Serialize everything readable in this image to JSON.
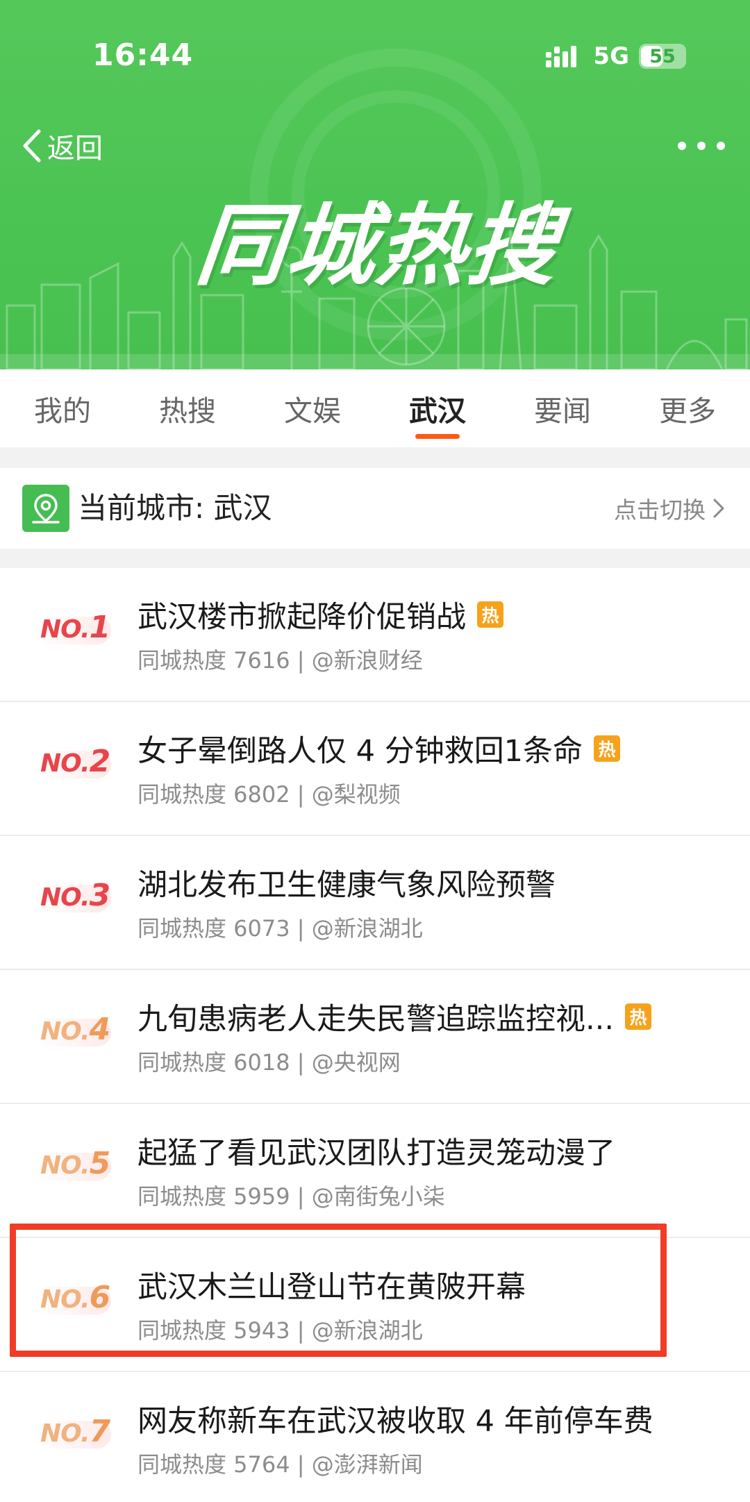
{
  "status_bar": {
    "time": "16:44",
    "network": "5G",
    "battery": "55",
    "battery_level": 0.55
  },
  "header": {
    "back_label": "返回",
    "banner_title": "同城热搜"
  },
  "tabs": [
    {
      "label": "我的",
      "active": false
    },
    {
      "label": "热搜",
      "active": false
    },
    {
      "label": "文娱",
      "active": false
    },
    {
      "label": "武汉",
      "active": true
    },
    {
      "label": "要闻",
      "active": false
    },
    {
      "label": "更多",
      "active": false
    }
  ],
  "city_bar": {
    "label": "当前城市: 武汉",
    "switch_label": "点击切换"
  },
  "hot_badge_label": "热",
  "colors": {
    "brand_green": "#4cc454",
    "tab_indicator": "#ff5a13",
    "rank_top": "#e8454a",
    "rank_other": "#f09a5a",
    "highlight": "#f23c26",
    "hot_badge": "#f7a21b"
  },
  "list": [
    {
      "rank_prefix": "NO.",
      "rank_num": "1",
      "title": "武汉楼市掀起降价促销战",
      "hot": true,
      "meta": "同城热度 7616 | @新浪财经"
    },
    {
      "rank_prefix": "NO.",
      "rank_num": "2",
      "title": "女子晕倒路人仅 4 分钟救回1条命",
      "hot": true,
      "meta": "同城热度 6802 | @梨视频"
    },
    {
      "rank_prefix": "NO.",
      "rank_num": "3",
      "title": "湖北发布卫生健康气象风险预警",
      "hot": false,
      "meta": "同城热度 6073 | @新浪湖北"
    },
    {
      "rank_prefix": "NO.",
      "rank_num": "4",
      "title": "九旬患病老人走失民警追踪监控视...",
      "hot": true,
      "meta": "同城热度 6018 | @央视网"
    },
    {
      "rank_prefix": "NO.",
      "rank_num": "5",
      "title": "起猛了看见武汉团队打造灵笼动漫了",
      "hot": false,
      "meta": "同城热度 5959 | @南街兔小柒"
    },
    {
      "rank_prefix": "NO.",
      "rank_num": "6",
      "title": "武汉木兰山登山节在黄陂开幕",
      "hot": false,
      "meta": "同城热度 5943 | @新浪湖北"
    },
    {
      "rank_prefix": "NO.",
      "rank_num": "7",
      "title": "网友称新车在武汉被收取 4 年前停车费",
      "hot": false,
      "meta": "同城热度 5764 | @澎湃新闻"
    }
  ]
}
